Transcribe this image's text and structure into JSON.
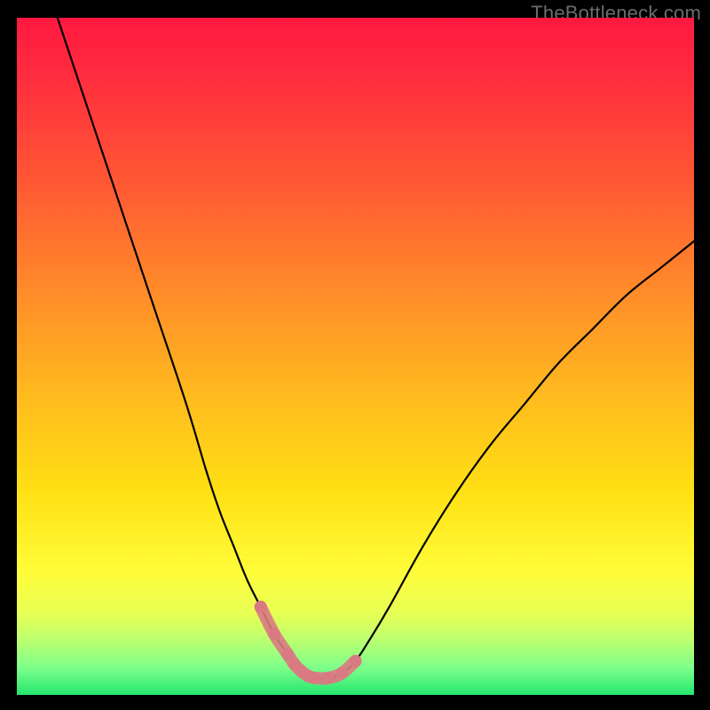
{
  "watermark": "TheBottleneck.com",
  "chart_data": {
    "type": "line",
    "title": "",
    "xlabel": "",
    "ylabel": "",
    "xlim": [
      0,
      100
    ],
    "ylim": [
      0,
      100
    ],
    "grid": false,
    "series": [
      {
        "name": "black-curve",
        "color": "#000000",
        "x": [
          6,
          10,
          15,
          20,
          25,
          28,
          30,
          32,
          34,
          36,
          38,
          40,
          41,
          42,
          43,
          44,
          46,
          48,
          50,
          52,
          55,
          60,
          65,
          70,
          75,
          80,
          85,
          90,
          95,
          100
        ],
        "values": [
          100,
          88,
          73,
          58,
          43,
          33,
          27,
          22,
          17,
          13,
          9,
          6,
          4.5,
          3.5,
          2.8,
          2.5,
          2.5,
          3.2,
          5,
          8,
          13,
          22,
          30,
          37,
          43,
          49,
          54,
          59,
          63,
          67
        ]
      },
      {
        "name": "pink-band",
        "color": "#d97a82",
        "x": [
          36,
          38,
          40,
          41,
          42,
          43,
          44,
          46,
          48,
          50
        ],
        "values": [
          13,
          9,
          6,
          4.5,
          3.5,
          2.8,
          2.5,
          2.5,
          3.2,
          5
        ]
      }
    ]
  }
}
